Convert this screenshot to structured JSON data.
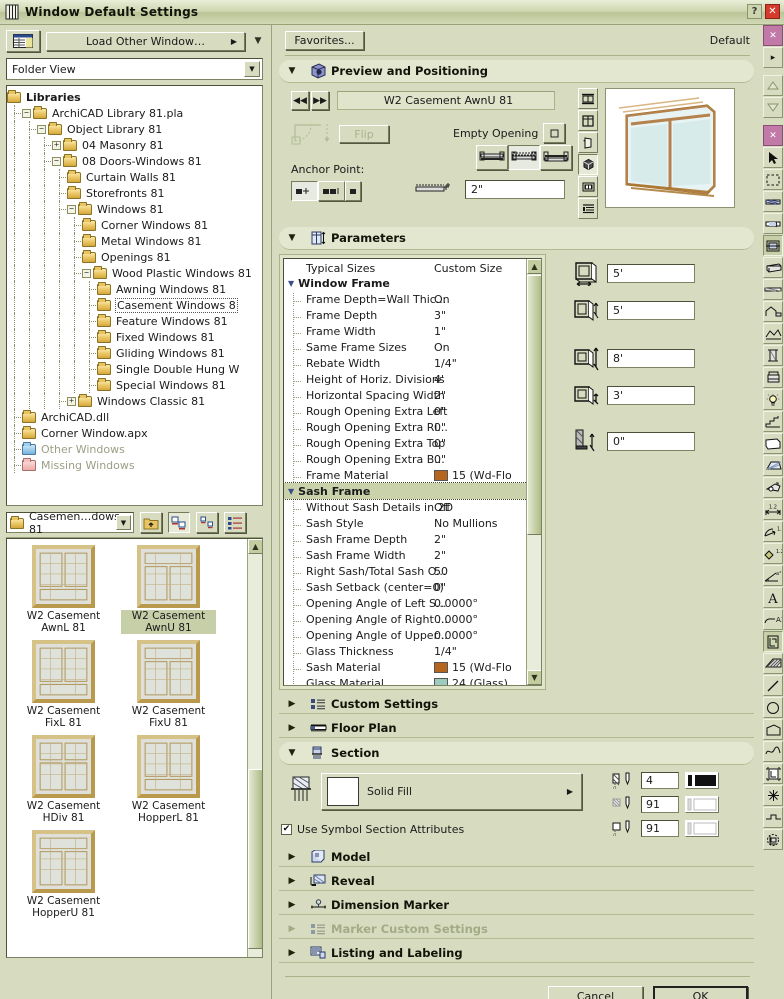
{
  "window": {
    "title": "Window Default Settings",
    "help_button": "?",
    "close_button": "✕"
  },
  "left_panel": {
    "view_mode_icon": "list-view-icon",
    "load_other_button": "Load Other Window…",
    "folder_view_combo": "Folder View",
    "tree": [
      {
        "label": "Libraries",
        "depth": 0,
        "bold": true,
        "expander": "",
        "folder": "yellow"
      },
      {
        "label": "ArchiCAD Library 81.pla",
        "depth": 1,
        "bold": false,
        "expander": "−",
        "folder": "yellow"
      },
      {
        "label": "Object Library 81",
        "depth": 2,
        "bold": false,
        "expander": "−",
        "folder": "yellow"
      },
      {
        "label": "04 Masonry 81",
        "depth": 3,
        "bold": false,
        "expander": "+",
        "folder": "yellow"
      },
      {
        "label": "08 Doors-Windows 81",
        "depth": 3,
        "bold": false,
        "expander": "−",
        "folder": "yellow"
      },
      {
        "label": "Curtain Walls 81",
        "depth": 4,
        "bold": false,
        "expander": "",
        "folder": "yellow"
      },
      {
        "label": "Storefronts 81",
        "depth": 4,
        "bold": false,
        "expander": "",
        "folder": "yellow"
      },
      {
        "label": "Windows 81",
        "depth": 4,
        "bold": false,
        "expander": "−",
        "folder": "yellow"
      },
      {
        "label": "Corner Windows 81",
        "depth": 5,
        "bold": false,
        "expander": "",
        "folder": "yellow"
      },
      {
        "label": "Metal Windows 81",
        "depth": 5,
        "bold": false,
        "expander": "",
        "folder": "yellow"
      },
      {
        "label": "Openings 81",
        "depth": 5,
        "bold": false,
        "expander": "",
        "folder": "yellow"
      },
      {
        "label": "Wood Plastic Windows 81",
        "depth": 5,
        "bold": false,
        "expander": "−",
        "folder": "yellow"
      },
      {
        "label": "Awning Windows 81",
        "depth": 6,
        "bold": false,
        "expander": "",
        "folder": "yellow"
      },
      {
        "label": "Casement Windows 8",
        "depth": 6,
        "bold": false,
        "expander": "",
        "folder": "yellow",
        "selected": true
      },
      {
        "label": "Feature Windows 81",
        "depth": 6,
        "bold": false,
        "expander": "",
        "folder": "yellow"
      },
      {
        "label": "Fixed Windows 81",
        "depth": 6,
        "bold": false,
        "expander": "",
        "folder": "yellow"
      },
      {
        "label": "Gliding Windows 81",
        "depth": 6,
        "bold": false,
        "expander": "",
        "folder": "yellow"
      },
      {
        "label": "Single Double Hung W",
        "depth": 6,
        "bold": false,
        "expander": "",
        "folder": "yellow"
      },
      {
        "label": "Special Windows 81",
        "depth": 6,
        "bold": false,
        "expander": "",
        "folder": "yellow"
      },
      {
        "label": "Windows Classic 81",
        "depth": 4,
        "bold": false,
        "expander": "+",
        "folder": "yellow"
      },
      {
        "label": "ArchiCAD.dll",
        "depth": 1,
        "bold": false,
        "expander": "",
        "folder": "yellow"
      },
      {
        "label": "Corner Window.apx",
        "depth": 1,
        "bold": false,
        "expander": "",
        "folder": "yellow"
      },
      {
        "label": "Other Windows",
        "depth": 1,
        "bold": false,
        "expander": "",
        "folder": "blue",
        "dim": true
      },
      {
        "label": "Missing Windows",
        "depth": 1,
        "bold": false,
        "expander": "",
        "folder": "pink",
        "dim": true
      }
    ],
    "browser": {
      "path_label": "Casemen…dows 81",
      "up_button_icon": "folder-up-icon",
      "view_large_icon": "large-icon-view-icon",
      "view_small_icon": "small-icon-view-icon",
      "view_list_icon": "detail-list-view-icon",
      "items": [
        {
          "caption": "W2 Casement AwnL 81",
          "selected": false,
          "style": "awnL"
        },
        {
          "caption": "W2 Casement AwnU 81",
          "selected": true,
          "style": "awnU"
        },
        {
          "caption": "W2 Casement FixL 81",
          "selected": false,
          "style": "fixL"
        },
        {
          "caption": "W2 Casement FixU 81",
          "selected": false,
          "style": "fixU"
        },
        {
          "caption": "W2 Casement HDiv 81",
          "selected": false,
          "style": "hdiv"
        },
        {
          "caption": "W2 Casement HopperL 81",
          "selected": false,
          "style": "hopL"
        },
        {
          "caption": "W2 Casement HopperU 81",
          "selected": false,
          "style": "hopU"
        }
      ]
    }
  },
  "right_panel": {
    "favorites_button": "Favorites...",
    "default_label": "Default",
    "sections": {
      "preview": {
        "title": "Preview and Positioning",
        "icon": "preview-cube-icon",
        "expanded": true,
        "object_name": "W2 Casement AwnU 81",
        "prev_button_icon": "prev-arrow-icon",
        "next_button_icon": "next-arrow-icon",
        "flip_button": "Flip",
        "empty_opening_label": "Empty Opening",
        "empty_opening_checked": false,
        "anchor_point_label": "Anchor Point:",
        "sill_height_value": "2\"",
        "view_tools": [
          {
            "icon": "elevation-view-icon",
            "active": false
          },
          {
            "icon": "front-view-icon",
            "active": false
          },
          {
            "icon": "3d-side-view-icon",
            "active": false
          },
          {
            "icon": "3d-perspective-icon",
            "active": true
          },
          {
            "icon": "section-view-icon",
            "active": false
          },
          {
            "icon": "list-view-icon",
            "active": false
          }
        ]
      },
      "parameters": {
        "title": "Parameters",
        "icon": "parameters-icon",
        "expanded": true,
        "columns": [
          "Typical Sizes",
          "Custom Size"
        ],
        "rows": [
          {
            "type": "group",
            "name": "Window Frame",
            "value": "",
            "highlight": false
          },
          {
            "type": "item",
            "name": "Frame Depth=Wall Thic...",
            "value": "On"
          },
          {
            "type": "item",
            "name": "Frame Depth",
            "value": "3\""
          },
          {
            "type": "item",
            "name": "Frame Width",
            "value": "1\""
          },
          {
            "type": "item",
            "name": "Same Frame Sizes",
            "value": "On"
          },
          {
            "type": "item",
            "name": "Rebate Width",
            "value": "1/4\""
          },
          {
            "type": "item",
            "name": "Height of Horiz. Divisions",
            "value": "4'"
          },
          {
            "type": "item",
            "name": "Horizontal Spacing Width",
            "value": "2\""
          },
          {
            "type": "item",
            "name": "Rough Opening Extra Left",
            "value": "0\""
          },
          {
            "type": "item",
            "name": "Rough Opening Extra Ri...",
            "value": "0\""
          },
          {
            "type": "item",
            "name": "Rough Opening Extra Top",
            "value": "0\""
          },
          {
            "type": "item",
            "name": "Rough Opening Extra B...",
            "value": "0\""
          },
          {
            "type": "item",
            "name": "Frame Material",
            "value": "15 (Wd-Flo",
            "swatch": "#b5651d"
          },
          {
            "type": "group",
            "name": "Sash Frame",
            "value": "",
            "highlight": true
          },
          {
            "type": "item",
            "name": "Without Sash Details in 2D",
            "value": "Off"
          },
          {
            "type": "item",
            "name": "Sash Style",
            "value": "No Mullions"
          },
          {
            "type": "item",
            "name": "Sash Frame Depth",
            "value": "2\""
          },
          {
            "type": "item",
            "name": "Sash Frame Width",
            "value": "2\""
          },
          {
            "type": "item",
            "name": "Right Sash/Total Sash O...",
            "value": "50"
          },
          {
            "type": "item",
            "name": "Sash Setback (center=0)",
            "value": "0\""
          },
          {
            "type": "item",
            "name": "Opening Angle of Left S...",
            "value": "0.0000°"
          },
          {
            "type": "item",
            "name": "Opening Angle of Right ...",
            "value": "0.0000°"
          },
          {
            "type": "item",
            "name": "Opening Angle of Upper...",
            "value": "0.0000°"
          },
          {
            "type": "item",
            "name": "Glass Thickness",
            "value": "1/4\""
          },
          {
            "type": "item",
            "name": "Sash Material",
            "value": "15 (Wd-Flo",
            "swatch": "#b5651d"
          },
          {
            "type": "item",
            "name": "Glass Material",
            "value": "24 (Glass)",
            "swatch": "#9ecbc0"
          }
        ],
        "size_fields": [
          {
            "icon": "window-width-icon",
            "value": "5'"
          },
          {
            "icon": "window-height-icon",
            "value": "5'"
          },
          {
            "icon": "head-height-icon",
            "value": "8'"
          },
          {
            "icon": "sill-height-icon",
            "value": "3'"
          },
          {
            "icon": "wall-sill-offset-icon",
            "value": "0\""
          }
        ]
      },
      "custom_settings": {
        "title": "Custom Settings",
        "icon": "custom-settings-icon",
        "expanded": false,
        "disabled": false
      },
      "floor_plan": {
        "title": "Floor Plan",
        "icon": "floor-plan-icon",
        "expanded": false,
        "disabled": false
      },
      "section": {
        "title": "Section",
        "icon": "section-icon",
        "expanded": true,
        "fill_label": "Solid Fill",
        "use_symbol_label": "Use Symbol Section Attributes",
        "use_symbol_checked": true,
        "pens": [
          {
            "icon": "cut-line-pen-icon",
            "value": "4"
          },
          {
            "icon": "fill-pen-icon",
            "value": "91"
          },
          {
            "icon": "fill-background-pen-icon",
            "value": "91"
          }
        ]
      },
      "model": {
        "title": "Model",
        "icon": "model-icon",
        "expanded": false,
        "disabled": false
      },
      "reveal": {
        "title": "Reveal",
        "icon": "reveal-icon",
        "expanded": false,
        "disabled": false
      },
      "dimension_marker": {
        "title": "Dimension Marker",
        "icon": "dimension-marker-icon",
        "expanded": false,
        "disabled": false
      },
      "marker_custom_settings": {
        "title": "Marker Custom Settings",
        "icon": "marker-custom-settings-icon",
        "expanded": false,
        "disabled": true
      },
      "listing_labeling": {
        "title": "Listing and Labeling",
        "icon": "listing-labeling-icon",
        "expanded": false,
        "disabled": false
      }
    },
    "footer": {
      "cancel_button": "Cancel",
      "ok_button": "OK"
    }
  },
  "toolbar_rail": {
    "top_items": [
      {
        "icon": "close-palette-icon",
        "kind": "close"
      },
      {
        "icon": "expand-arrow-icon",
        "kind": "btn"
      }
    ],
    "scroll_items": [
      {
        "icon": "scroll-up-icon"
      },
      {
        "icon": "scroll-down-icon"
      }
    ],
    "tools": [
      {
        "icon": "close-palette-icon",
        "kind": "close"
      },
      {
        "icon": "arrow-select-tool-icon"
      },
      {
        "icon": "marquee-tool-icon"
      },
      {
        "icon": "wall-tool-icon"
      },
      {
        "icon": "door-tool-icon"
      },
      {
        "icon": "window-tool-icon",
        "selected": true
      },
      {
        "icon": "beam-tool-icon"
      },
      {
        "icon": "slab-tool-icon"
      },
      {
        "icon": "roof-tool-icon"
      },
      {
        "icon": "mesh-tool-icon"
      },
      {
        "icon": "column-tool-icon"
      },
      {
        "icon": "object-tool-icon"
      },
      {
        "icon": "lamp-tool-icon"
      },
      {
        "icon": "stair-tool-icon"
      },
      {
        "icon": "zone-tool-icon"
      },
      {
        "icon": "roof-light-tool-icon"
      },
      {
        "icon": "camera-tool-icon"
      },
      {
        "icon": "linear-dimension-icon"
      },
      {
        "icon": "radial-dimension-icon"
      },
      {
        "icon": "level-dimension-icon"
      },
      {
        "icon": "angle-dimension-icon"
      },
      {
        "icon": "text-tool-icon"
      },
      {
        "icon": "label-tool-icon"
      },
      {
        "icon": "figure-tool-icon",
        "selected2": true
      },
      {
        "icon": "fill-tool-icon"
      },
      {
        "icon": "line-tool-icon"
      },
      {
        "icon": "circle-tool-icon"
      },
      {
        "icon": "polyline-tool-icon"
      },
      {
        "icon": "spline-tool-icon"
      },
      {
        "icon": "drawing-tool-icon"
      },
      {
        "icon": "hotspot-tool-icon"
      },
      {
        "icon": "section-elevation-tool-icon"
      },
      {
        "icon": "detail-tool-icon"
      }
    ]
  }
}
